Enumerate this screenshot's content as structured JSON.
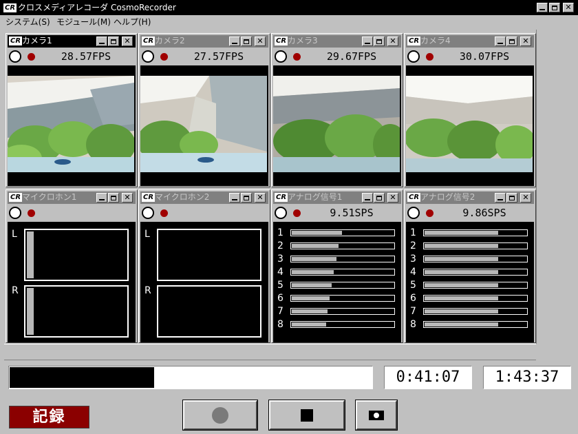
{
  "app": {
    "logo": "CR",
    "title": "クロスメディアレコーダ CosmoRecorder"
  },
  "menu": {
    "items": [
      {
        "label": "システム(S)"
      },
      {
        "label": "モジュール(M)"
      },
      {
        "label": "ヘルプ(H)"
      }
    ]
  },
  "cameras": [
    {
      "name": "カメラ1",
      "rate": "28.57FPS",
      "active": true
    },
    {
      "name": "カメラ2",
      "rate": "27.57FPS",
      "active": false
    },
    {
      "name": "カメラ3",
      "rate": "29.67FPS",
      "active": false
    },
    {
      "name": "カメラ4",
      "rate": "30.07FPS",
      "active": false
    }
  ],
  "microphones": [
    {
      "name": "マイクロホン1",
      "left_label": "L",
      "right_label": "R",
      "left_level": 0.07,
      "right_level": 0.07
    },
    {
      "name": "マイクロホン2",
      "left_label": "L",
      "right_label": "R",
      "left_level": 0.0,
      "right_level": 0.0
    }
  ],
  "analog": [
    {
      "name": "アナログ信号1",
      "rate": "9.51SPS",
      "channels": [
        {
          "label": "1",
          "level": 0.49
        },
        {
          "label": "2",
          "level": 0.46
        },
        {
          "label": "3",
          "level": 0.44
        },
        {
          "label": "4",
          "level": 0.41
        },
        {
          "label": "5",
          "level": 0.39
        },
        {
          "label": "6",
          "level": 0.37
        },
        {
          "label": "7",
          "level": 0.35
        },
        {
          "label": "8",
          "level": 0.34
        }
      ]
    },
    {
      "name": "アナログ信号2",
      "rate": "9.86SPS",
      "channels": [
        {
          "label": "1",
          "level": 0.72
        },
        {
          "label": "2",
          "level": 0.72
        },
        {
          "label": "3",
          "level": 0.72
        },
        {
          "label": "4",
          "level": 0.72
        },
        {
          "label": "5",
          "level": 0.72
        },
        {
          "label": "6",
          "level": 0.72
        },
        {
          "label": "7",
          "level": 0.72
        },
        {
          "label": "8",
          "level": 0.72
        }
      ]
    }
  ],
  "status": {
    "progress": 0.4,
    "elapsed": "0:41:07",
    "total": "1:43:37",
    "record_label": "記録"
  },
  "colors": {
    "record_badge": "#8b0000",
    "record_dot": "#a00000",
    "window_bg": "#c0c0c0"
  },
  "icons": {
    "record": "circle-icon",
    "stop": "square-icon",
    "snapshot": "camera-icon"
  }
}
